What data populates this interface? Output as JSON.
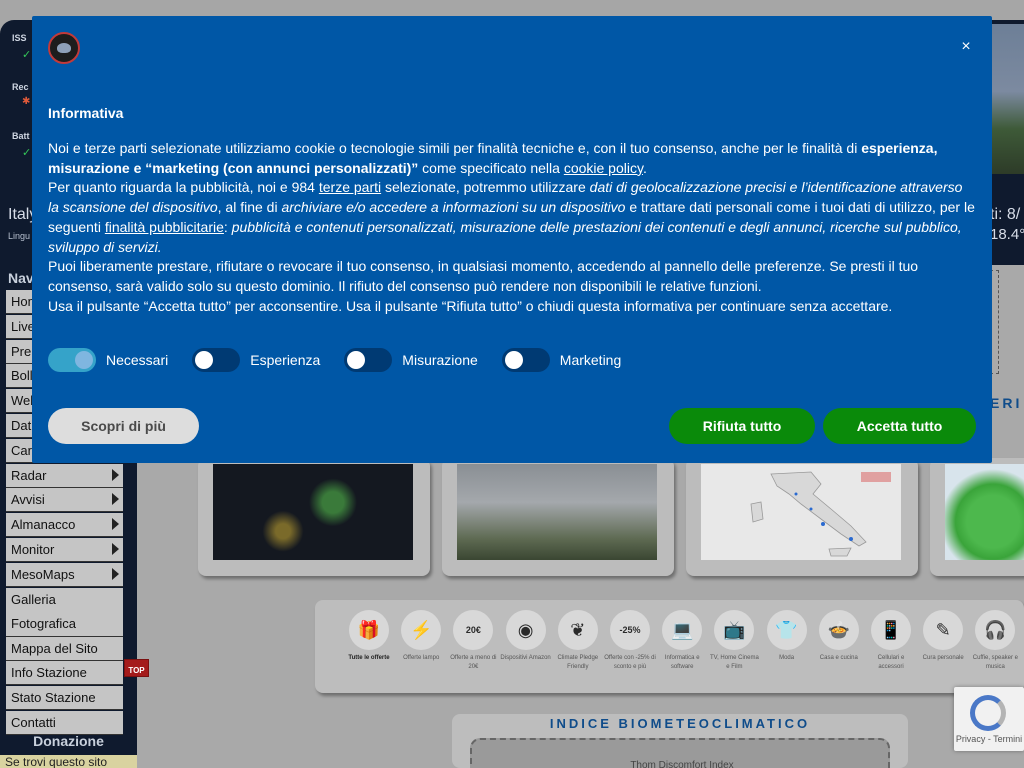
{
  "background": {
    "status": [
      {
        "label": "ISS",
        "symbol": "✓"
      },
      {
        "label": "Rec",
        "symbol": "✱"
      },
      {
        "label": "Batt",
        "symbol": "✓"
      }
    ],
    "location_text": "Italy",
    "language_text": "Lingu",
    "right_text_1": "ti:  8/",
    "right_text_2": "18.4°",
    "sidebar": {
      "title": "Nav",
      "items": [
        {
          "label": "Hom",
          "arrow": false
        },
        {
          "label": "Live",
          "arrow": false
        },
        {
          "label": "Pre",
          "arrow": false
        },
        {
          "label": "Boll",
          "arrow": false
        },
        {
          "label": "Web",
          "arrow": false
        },
        {
          "label": "Dati",
          "arrow": false
        },
        {
          "label": "Car",
          "arrow": false
        },
        {
          "label": "Radar",
          "arrow": true
        },
        {
          "label": "Avvisi",
          "arrow": true
        },
        {
          "label": "Almanacco",
          "arrow": true
        },
        {
          "label": "Monitor",
          "arrow": true
        },
        {
          "label": "MesoMaps",
          "arrow": true
        },
        {
          "label": "Galleria Fotografica",
          "arrow": false
        },
        {
          "label": "Mappa del Sito",
          "arrow": false
        },
        {
          "label": "Info Stazione",
          "arrow": false
        },
        {
          "label": "Stato Stazione",
          "arrow": false
        },
        {
          "label": "Contatti",
          "arrow": false
        }
      ],
      "top_button": "TOP",
      "donazione": "Donazione",
      "se_trovi": "Se trovi questo sito"
    },
    "cards_edge_label": "ERI",
    "amazon_items": [
      {
        "icon": "gift-icon",
        "glyph": "🎁",
        "label": "Tutte le offerte"
      },
      {
        "icon": "lightning-icon",
        "glyph": "⚡",
        "label": "Offerte lampo"
      },
      {
        "icon": "price-20-icon",
        "glyph": "20€",
        "label": "Offerte a meno di 20€"
      },
      {
        "icon": "amazon-device-icon",
        "glyph": "◉",
        "label": "Dispositivi Amazon"
      },
      {
        "icon": "climate-pledge-icon",
        "glyph": "❦",
        "label": "Climate Pledge Friendly"
      },
      {
        "icon": "discount-icon",
        "glyph": "-25%",
        "label": "Offerte con -25% di sconto e più"
      },
      {
        "icon": "laptop-icon",
        "glyph": "💻",
        "label": "Informatica e software"
      },
      {
        "icon": "tv-icon",
        "glyph": "📺",
        "label": "TV, Home Cinema e Film"
      },
      {
        "icon": "shirt-icon",
        "glyph": "👕",
        "label": "Moda"
      },
      {
        "icon": "cooking-pot-icon",
        "glyph": "🍲",
        "label": "Casa e cucina"
      },
      {
        "icon": "phone-icon",
        "glyph": "📱",
        "label": "Cellulari e accessori"
      },
      {
        "icon": "personal-care-icon",
        "glyph": "✎",
        "label": "Cura personale"
      },
      {
        "icon": "headphones-icon",
        "glyph": "🎧",
        "label": "Cuffie, speaker e musica"
      }
    ],
    "indice": {
      "title": "INDICE BIOMETEOCLIMATICO",
      "subtitle": "Thom Discomfort Index"
    },
    "recaptcha": {
      "text": "Privacy - Termini"
    }
  },
  "consent": {
    "heading": "Informativa",
    "paragraph_1": {
      "pre": "Noi e terze parti selezionate utilizziamo cookie o tecnologie simili per finalità tecniche e, con il tuo consenso, anche per le finalità di ",
      "bold": "esperienza, misurazione e “marketing (con annunci personalizzati)”",
      "mid": " come specificato nella ",
      "link": "cookie policy",
      "post": "."
    },
    "paragraph_2": {
      "pre": "Per quanto riguarda la pubblicità, noi e 984 ",
      "link1": "terze parti",
      "mid1": " selezionate, potremmo utilizzare ",
      "italic1": "dati di geolocalizzazione precisi e l’identificazione attraverso la scansione del dispositivo",
      "mid2": ", al fine di ",
      "italic2": "archiviare e/o accedere a informazioni su un dispositivo",
      "mid3": " e trattare dati personali come i tuoi dati di utilizzo, per le seguenti ",
      "link2": "finalità pubblicitarie",
      "mid4": ": ",
      "italic3": "pubblicità e contenuti personalizzati, misurazione delle prestazioni dei contenuti e degli annunci, ricerche sul pubblico, sviluppo di servizi."
    },
    "paragraph_3": "Puoi liberamente prestare, rifiutare o revocare il tuo consenso, in qualsiasi momento, accedendo al pannello delle preferenze. Se presti il tuo consenso, sarà valido solo su questo dominio. Il rifiuto del consenso può rendere non disponibili le relative funzioni.",
    "paragraph_4": "Usa il pulsante “Accetta tutto” per acconsentire. Usa il pulsante “Rifiuta tutto” o chiudi questa informativa per continuare senza accettare.",
    "toggles": [
      {
        "label": "Necessari",
        "on": true
      },
      {
        "label": "Esperienza",
        "on": false
      },
      {
        "label": "Misurazione",
        "on": false
      },
      {
        "label": "Marketing",
        "on": false
      }
    ],
    "buttons": {
      "learn_more": "Scopri di più",
      "reject_all": "Rifiuta tutto",
      "accept_all": "Accetta tutto"
    },
    "close_glyph": "×",
    "colors": {
      "modal_bg": "#0057a6",
      "button_green": "#0a8a0a",
      "toggle_on": "#35a3c9"
    }
  }
}
